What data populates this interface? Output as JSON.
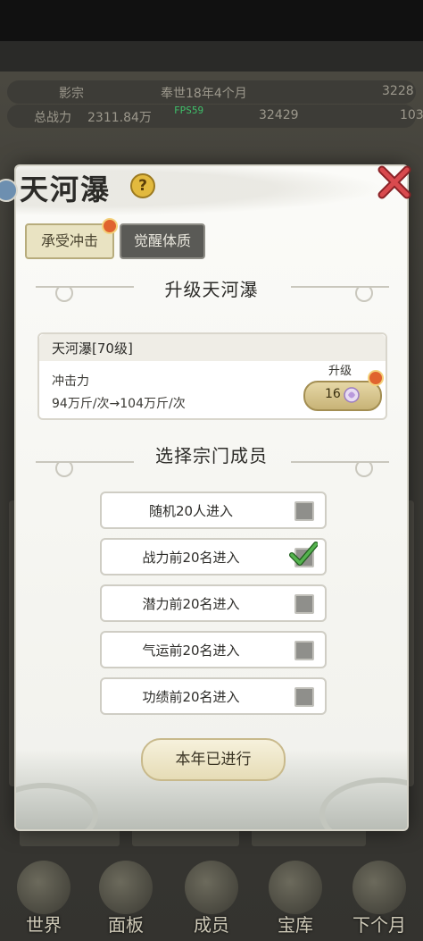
{
  "background": {
    "sect_name": "影宗",
    "era": "奉世18年4个月",
    "stat_right_top": "3228",
    "combat_label": "总战力",
    "combat_value": "2311.84万",
    "fps": "FPS59",
    "stat_right_mid": "32429",
    "stat_right_mid2": "103"
  },
  "bottom_nav": [
    {
      "label": "世界",
      "icon": "world-icon"
    },
    {
      "label": "面板",
      "icon": "panel-icon"
    },
    {
      "label": "成员",
      "icon": "members-icon"
    },
    {
      "label": "宝库",
      "icon": "treasury-icon"
    },
    {
      "label": "下个月",
      "icon": "next-month-icon"
    }
  ],
  "modal": {
    "title": "天河瀑",
    "tabs": [
      {
        "label": "承受冲击",
        "active": true
      },
      {
        "label": "觉醒体质",
        "active": false
      }
    ],
    "upgrade_section_title": "升级天河瀑",
    "skill": {
      "name": "天河瀑[70级]",
      "stat_label": "冲击力",
      "change": "94万斤/次→104万斤/次",
      "upgrade_label": "升级",
      "upgrade_cost": "16"
    },
    "select_section_title": "选择宗门成员",
    "options": [
      {
        "label": "随机20人进入",
        "checked": false
      },
      {
        "label": "战力前20名进入",
        "checked": true
      },
      {
        "label": "潜力前20名进入",
        "checked": false
      },
      {
        "label": "气运前20名进入",
        "checked": false
      },
      {
        "label": "功绩前20名进入",
        "checked": false
      }
    ],
    "done_button": "本年已进行"
  },
  "colors": {
    "accent_gold": "#c8b377",
    "checked_green": "#3e9b3c",
    "close_red": "#c8353a"
  }
}
